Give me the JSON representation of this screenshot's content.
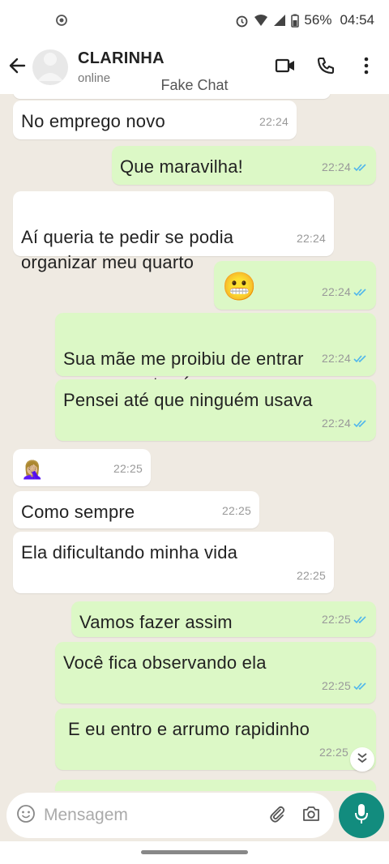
{
  "status_bar": {
    "battery": "56%",
    "time": "04:54",
    "icons": [
      "sync-icon",
      "alarm-icon",
      "wifi-icon",
      "signal-icon",
      "battery-icon"
    ]
  },
  "header": {
    "contact_name": "CLARINHA",
    "status": "online",
    "watermark": "Fake Chat",
    "icons": [
      "back-arrow-icon",
      "avatar-icon",
      "video-call-icon",
      "phone-icon",
      "more-icon"
    ]
  },
  "messages": [
    {
      "dir": "in",
      "text": "No emprego novo",
      "time": "22:24"
    },
    {
      "dir": "out",
      "text": "Que maravilha!",
      "time": "22:24"
    },
    {
      "dir": "in",
      "text": "Aí queria te pedir se podia\norganizar meu quarto",
      "time": "22:24"
    },
    {
      "dir": "out",
      "text": "😬",
      "time": "22:24"
    },
    {
      "dir": "out",
      "text": "Sua mãe me proibiu de entrar\nnesse quarto aí",
      "time": "22:24"
    },
    {
      "dir": "out",
      "text": "Pensei até que ninguém usava",
      "time": "22:24"
    },
    {
      "dir": "in",
      "text": "🤦🏼‍♀️",
      "time": "22:25"
    },
    {
      "dir": "in",
      "text": "Como sempre",
      "time": "22:25"
    },
    {
      "dir": "in",
      "text": "Ela dificultando minha vida",
      "time": "22:25"
    },
    {
      "dir": "out",
      "text": "Vamos fazer assim",
      "time": "22:25"
    },
    {
      "dir": "out",
      "text": "Você fica observando ela",
      "time": "22:25"
    },
    {
      "dir": "out",
      "text": "E eu entro e arrumo rapidinho",
      "time": "22:25"
    }
  ],
  "colors": {
    "incoming": "#ffffff",
    "outgoing": "#dcf8c6",
    "chat_bg": "#efeae2",
    "read_tick": "#4fb6ec",
    "mic_button": "#128c7e"
  },
  "input": {
    "placeholder": "Mensagem",
    "icons": [
      "emoji-icon",
      "attach-icon",
      "camera-icon",
      "mic-icon"
    ]
  }
}
